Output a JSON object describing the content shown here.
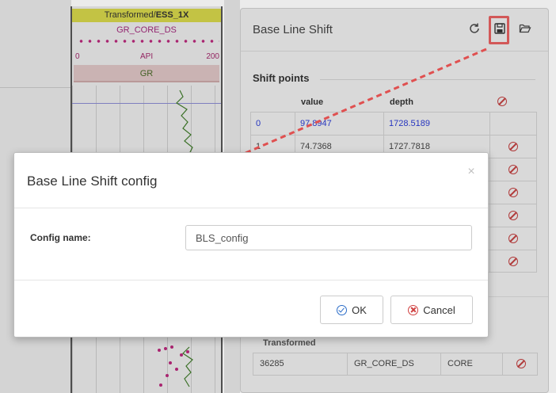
{
  "log_track": {
    "title_prefix": "Transformed/",
    "title_bold": "ESS_1X",
    "curve_name": "GR_CORE_DS",
    "scale_min": "0",
    "scale_unit": "API",
    "scale_max": "200",
    "band_label": "GR"
  },
  "panel": {
    "title": "Base Line Shift",
    "icons": [
      "refresh-icon",
      "save-icon",
      "folder-open-icon"
    ],
    "section_title": "Shift points",
    "columns": {
      "value": "value",
      "depth": "depth"
    },
    "rows": [
      {
        "index": "0",
        "value": "97.8947",
        "depth": "1728.5189"
      },
      {
        "index": "1",
        "value": "74.7368",
        "depth": "1727.7818"
      },
      {
        "index": "",
        "value": "",
        "depth": ""
      },
      {
        "index": "",
        "value": "",
        "depth": ""
      },
      {
        "index": "",
        "value": "",
        "depth": ""
      },
      {
        "index": "",
        "value": "",
        "depth": ""
      },
      {
        "index": "",
        "value": "",
        "depth": ""
      }
    ],
    "transformed_label": "Transformed",
    "transformed_row": {
      "id": "36285",
      "curve": "GR_CORE_DS",
      "source": "CORE"
    }
  },
  "modal": {
    "title": "Base Line Shift config",
    "close_glyph": "×",
    "field_label": "Config name:",
    "field_value": "BLS_config",
    "ok_label": "OK",
    "cancel_label": "Cancel"
  },
  "colors": {
    "highlight": "#e46060",
    "arrow": "#e05050",
    "ok_icon": "#2a6cc8",
    "cancel_icon": "#d04040"
  }
}
